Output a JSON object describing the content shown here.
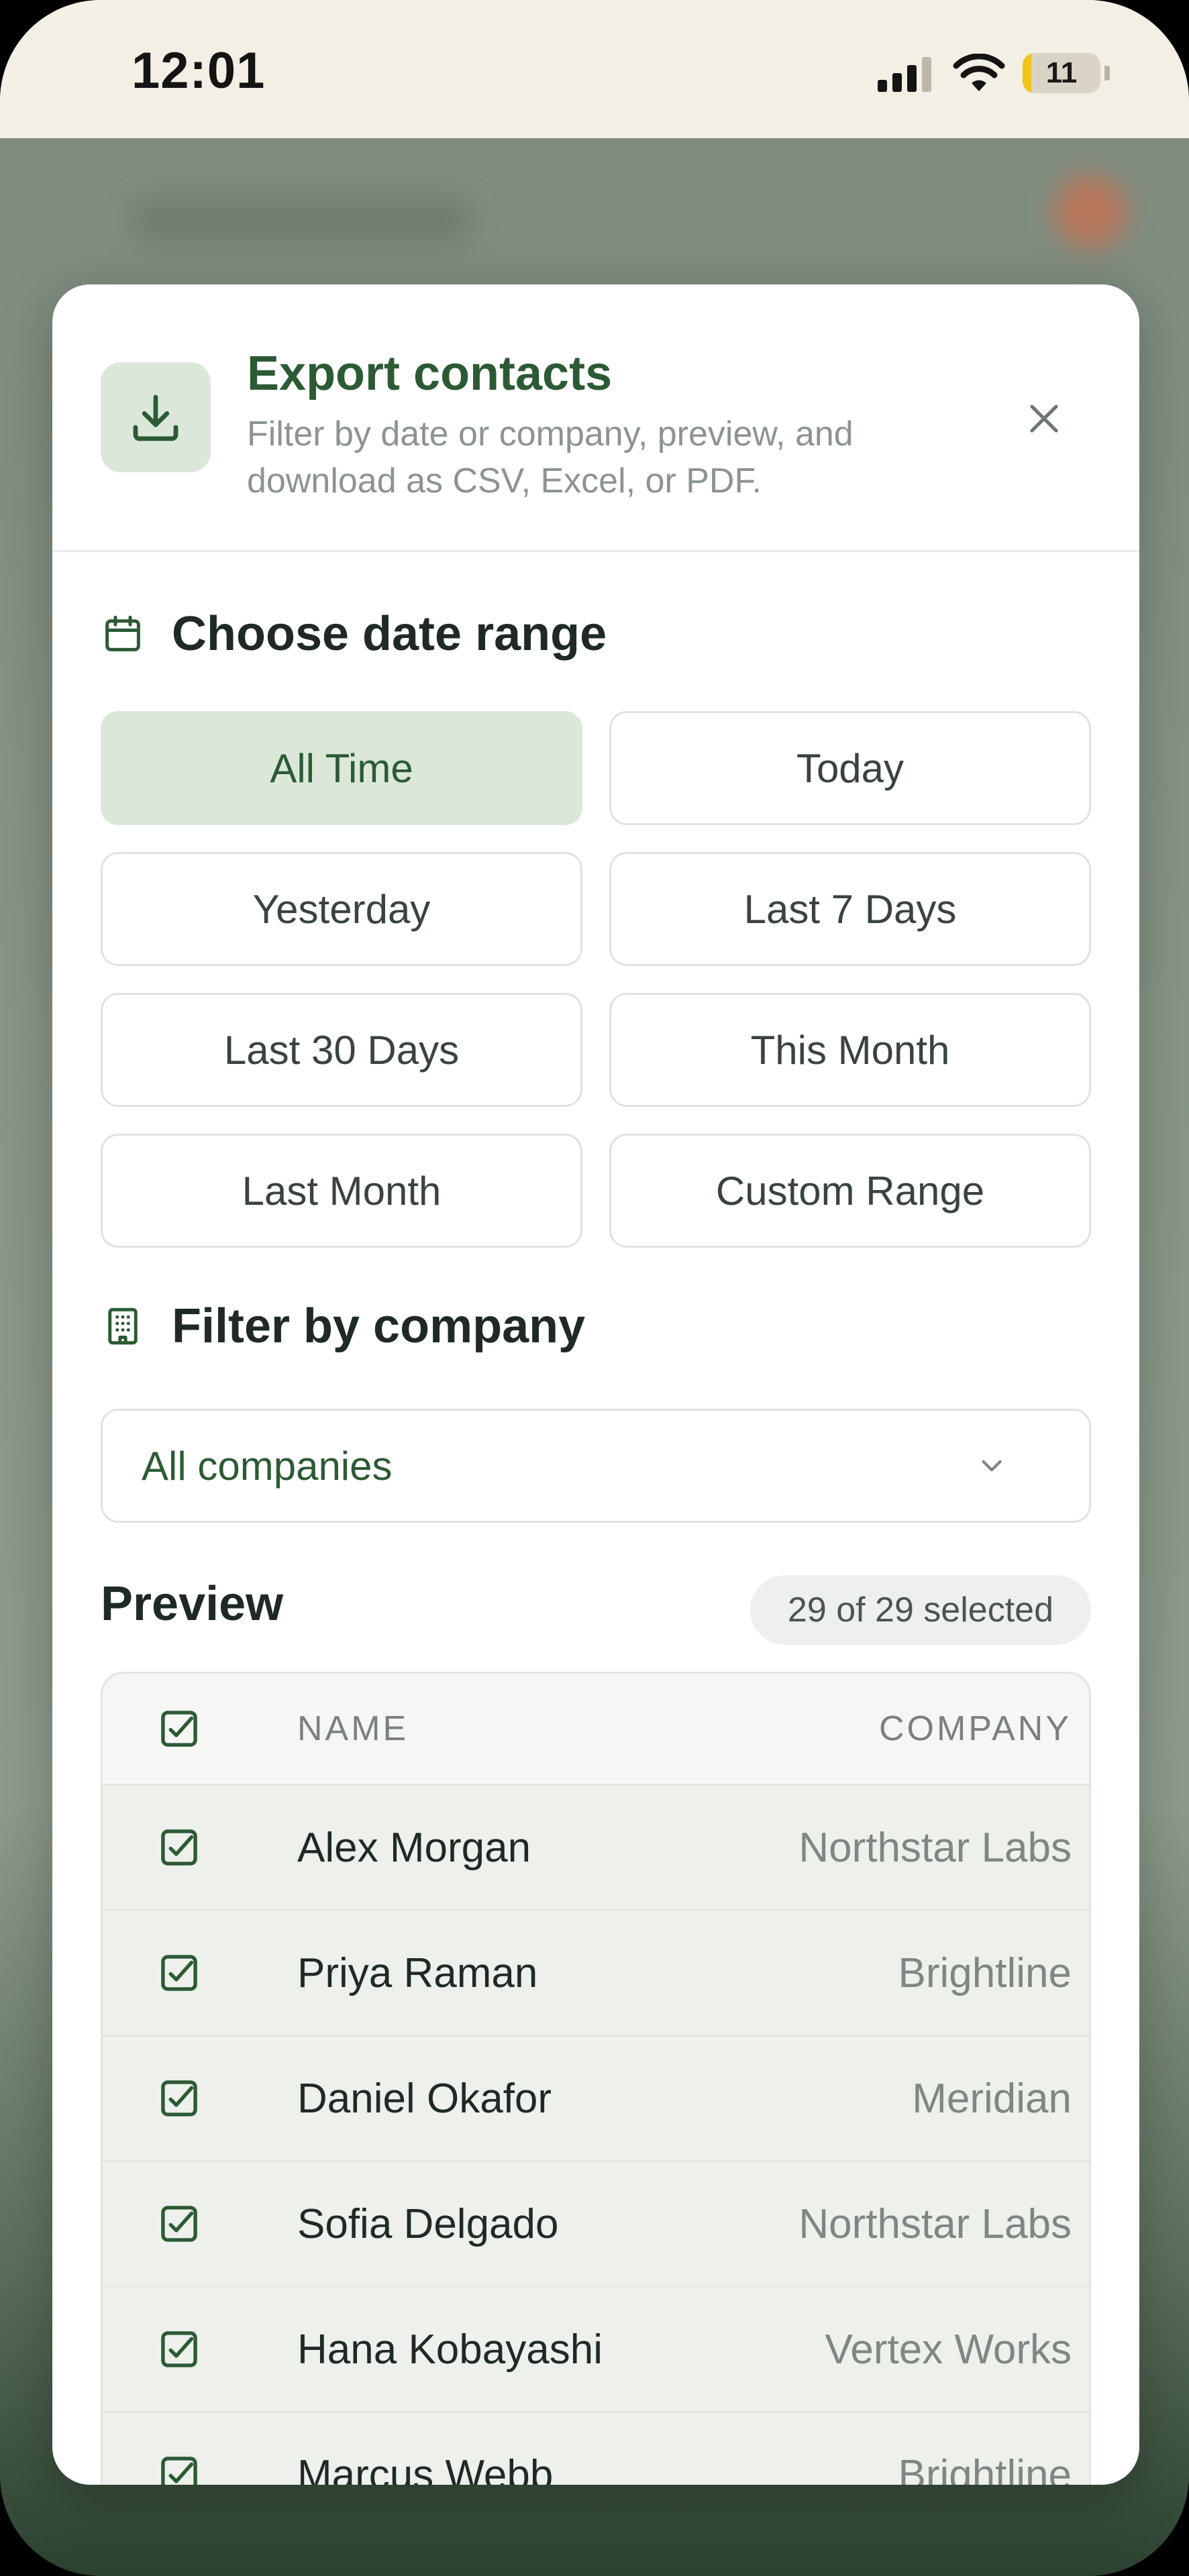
{
  "status_bar": {
    "time": "12:01",
    "battery_level": "11",
    "battery_fraction": 0.11,
    "battery_color": "#f1c21a"
  },
  "dialog": {
    "title": "Export contacts",
    "subtitle": "Filter by date or company, preview, and download as CSV, Excel, or PDF.",
    "header_icon": "download-icon",
    "close_icon": "close-icon",
    "accent_color": "#2c5a35"
  },
  "date_range": {
    "title": "Choose date range",
    "icon": "calendar-icon",
    "options": [
      "All Time",
      "Today",
      "Yesterday",
      "Last 7 Days",
      "Last 30 Days",
      "This Month",
      "Last Month",
      "Custom Range"
    ],
    "selected": "All Time"
  },
  "company_filter": {
    "title": "Filter by company",
    "icon": "building-icon",
    "selected_value": "All companies"
  },
  "preview": {
    "title": "Preview",
    "selected_count": "29 of 29 selected",
    "columns": {
      "name": "NAME",
      "company": "COMPANY"
    },
    "rows": [
      {
        "name": "Alex Morgan",
        "company": "Northstar Labs",
        "checked": true
      },
      {
        "name": "Priya Raman",
        "company": "Brightline",
        "checked": true
      },
      {
        "name": "Daniel Okafor",
        "company": "Meridian",
        "checked": true
      },
      {
        "name": "Sofia Delgado",
        "company": "Northstar Labs",
        "checked": true
      },
      {
        "name": "Hana Kobayashi",
        "company": "Vertex Works",
        "checked": true
      },
      {
        "name": "Marcus Webb",
        "company": "Brightline",
        "checked": true
      }
    ]
  }
}
